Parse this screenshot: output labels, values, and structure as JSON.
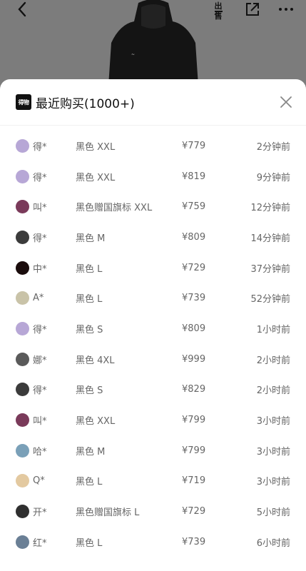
{
  "topbar": {
    "back_icon": "chevron-left-icon",
    "sell_label_top": "出",
    "sell_label_bottom": "售",
    "share_icon": "share-icon",
    "more_icon": "more-dots-icon"
  },
  "sheet": {
    "logo_text": "得物",
    "title": "最近购买(1000+)",
    "close_icon": "close-icon"
  },
  "rows": [
    {
      "user": "得*",
      "spec": "黑色 XXL",
      "price": "¥779",
      "time": "2分钟前",
      "avatar_color": "#b7a7d6"
    },
    {
      "user": "得*",
      "spec": "黑色 XXL",
      "price": "¥819",
      "time": "9分钟前",
      "avatar_color": "#b7a7d6"
    },
    {
      "user": "叫*",
      "spec": "黑色赠国旗标 XXL",
      "price": "¥759",
      "time": "12分钟前",
      "avatar_color": "#7a3a5a"
    },
    {
      "user": "得*",
      "spec": "黑色 M",
      "price": "¥809",
      "time": "14分钟前",
      "avatar_color": "#3b3b3b"
    },
    {
      "user": "中*",
      "spec": "黑色 L",
      "price": "¥729",
      "time": "37分钟前",
      "avatar_color": "#1a0c0c"
    },
    {
      "user": "A*",
      "spec": "黑色 L",
      "price": "¥739",
      "time": "52分钟前",
      "avatar_color": "#c9c3a8"
    },
    {
      "user": "得*",
      "spec": "黑色 S",
      "price": "¥809",
      "time": "1小时前",
      "avatar_color": "#b7a7d6"
    },
    {
      "user": "娜*",
      "spec": "黑色 4XL",
      "price": "¥999",
      "time": "2小时前",
      "avatar_color": "#5a5a5a"
    },
    {
      "user": "得*",
      "spec": "黑色 S",
      "price": "¥829",
      "time": "2小时前",
      "avatar_color": "#3b3b3b"
    },
    {
      "user": "叫*",
      "spec": "黑色 XXL",
      "price": "¥799",
      "time": "3小时前",
      "avatar_color": "#7a3a5a"
    },
    {
      "user": "哈*",
      "spec": "黑色 M",
      "price": "¥799",
      "time": "3小时前",
      "avatar_color": "#7aa0b8"
    },
    {
      "user": "Q*",
      "spec": "黑色 L",
      "price": "¥719",
      "time": "3小时前",
      "avatar_color": "#e3c9a0"
    },
    {
      "user": "开*",
      "spec": "黑色赠国旗标 L",
      "price": "¥729",
      "time": "5小时前",
      "avatar_color": "#2f2f2f"
    },
    {
      "user": "红*",
      "spec": "黑色 L",
      "price": "¥739",
      "time": "6小时前",
      "avatar_color": "#6a7f95"
    }
  ]
}
